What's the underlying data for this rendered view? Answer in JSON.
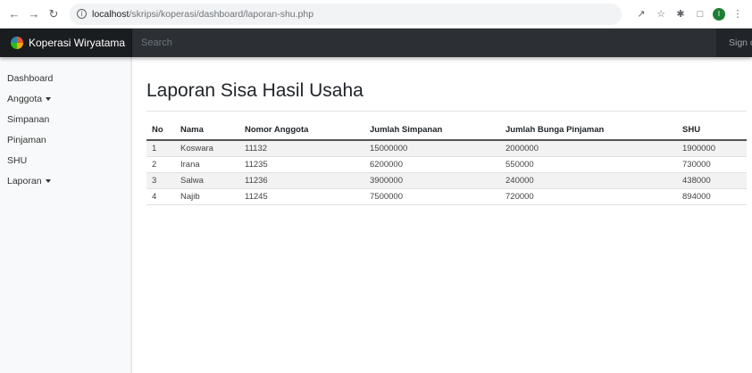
{
  "browser": {
    "url_host": "localhost",
    "url_path": "/skripsi/koperasi/dashboard/laporan-shu.php",
    "profile_initial": "I"
  },
  "navbar": {
    "brand": "Koperasi Wiryatama",
    "search_placeholder": "Search",
    "signout": "Sign out"
  },
  "sidebar": {
    "items": [
      {
        "label": "Dashboard",
        "dropdown": false
      },
      {
        "label": "Anggota",
        "dropdown": true
      },
      {
        "label": "Simpanan",
        "dropdown": false
      },
      {
        "label": "Pinjaman",
        "dropdown": false
      },
      {
        "label": "SHU",
        "dropdown": false
      },
      {
        "label": "Laporan",
        "dropdown": true
      }
    ]
  },
  "main": {
    "title": "Laporan Sisa Hasil Usaha",
    "table": {
      "headers": [
        "No",
        "Nama",
        "Nomor Anggota",
        "Jumlah Simpanan",
        "Jumlah Bunga Pinjaman",
        "SHU"
      ],
      "rows": [
        [
          "1",
          "Koswara",
          "11132",
          "15000000",
          "2000000",
          "1900000"
        ],
        [
          "2",
          "Irana",
          "11235",
          "6200000",
          "550000",
          "730000"
        ],
        [
          "3",
          "Salwa",
          "11236",
          "3900000",
          "240000",
          "438000"
        ],
        [
          "4",
          "Najib",
          "11245",
          "7500000",
          "720000",
          "894000"
        ]
      ]
    }
  }
}
